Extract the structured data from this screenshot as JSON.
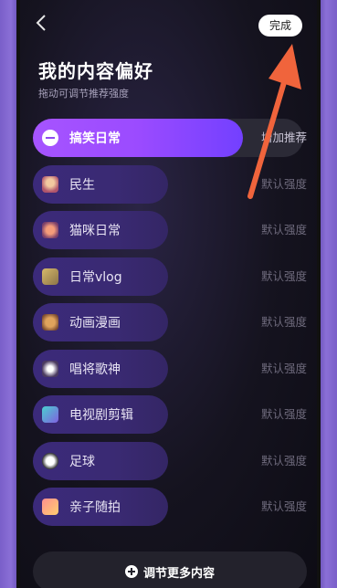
{
  "header": {
    "back_icon": "chevron-left-icon",
    "done_label": "完成",
    "title": "我的内容偏好",
    "subtitle": "拖动可调节推荐强度"
  },
  "items": [
    {
      "label": "搞笑日常",
      "strength": "增加推荐",
      "active": true,
      "icon": "minus-circle-icon"
    },
    {
      "label": "民生",
      "strength": "默认强度",
      "active": false,
      "icon": "people-icon"
    },
    {
      "label": "猫咪日常",
      "strength": "默认强度",
      "active": false,
      "icon": "cat-icon"
    },
    {
      "label": "日常vlog",
      "strength": "默认强度",
      "active": false,
      "icon": "daily-icon"
    },
    {
      "label": "动画漫画",
      "strength": "默认强度",
      "active": false,
      "icon": "anime-icon"
    },
    {
      "label": "唱将歌神",
      "strength": "默认强度",
      "active": false,
      "icon": "sing-icon"
    },
    {
      "label": "电视剧剪辑",
      "strength": "默认强度",
      "active": false,
      "icon": "tv-icon"
    },
    {
      "label": "足球",
      "strength": "默认强度",
      "active": false,
      "icon": "football-icon"
    },
    {
      "label": "亲子随拍",
      "strength": "默认强度",
      "active": false,
      "icon": "family-icon"
    }
  ],
  "footer": {
    "more_label": "调节更多内容",
    "plus_icon": "plus-circle-icon"
  },
  "annotation": {
    "arrow_color": "#f0643c"
  }
}
